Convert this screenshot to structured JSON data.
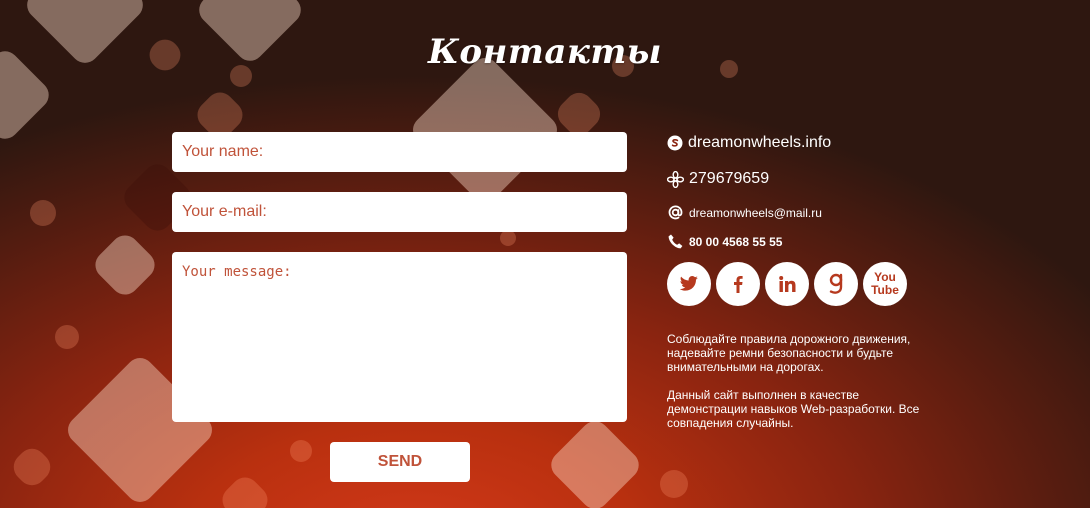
{
  "page": {
    "title": "Контакты"
  },
  "form": {
    "name_placeholder": "Your name:",
    "email_placeholder": "Your e-mail:",
    "message_placeholder": "Your message:",
    "send_label": "SEND"
  },
  "contacts": {
    "skype": {
      "icon": "skype-icon",
      "text": "dreamonwheels.info"
    },
    "icq": {
      "icon": "icq-flower-icon",
      "text": "279679659"
    },
    "email": {
      "icon": "at-sign-icon",
      "text": "dreamonwheels@mail.ru"
    },
    "phone": {
      "icon": "phone-icon",
      "text": "80 00 4568 55 55"
    }
  },
  "socials": [
    {
      "icon": "twitter-icon",
      "label": ""
    },
    {
      "icon": "facebook-icon",
      "label": ""
    },
    {
      "icon": "linkedin-icon",
      "label": ""
    },
    {
      "icon": "google-g-icon",
      "label": ""
    },
    {
      "icon": "youtube-icon",
      "label_top": "You",
      "label_bottom": "Tube"
    }
  ],
  "notes": {
    "note1": "Соблюдайте правила дорожного движения, надевайте ремни безопасности и будьте внимательными на дорогах.",
    "note2": "Данный сайт выполнен в качестве демонстрации навыков Web-разработки. Все совпадения случайны."
  },
  "colors": {
    "accent_text": "#c0533a",
    "background_top": "#2e1710",
    "background_bottom": "#d4391a",
    "social_icon": "#b6391e"
  }
}
